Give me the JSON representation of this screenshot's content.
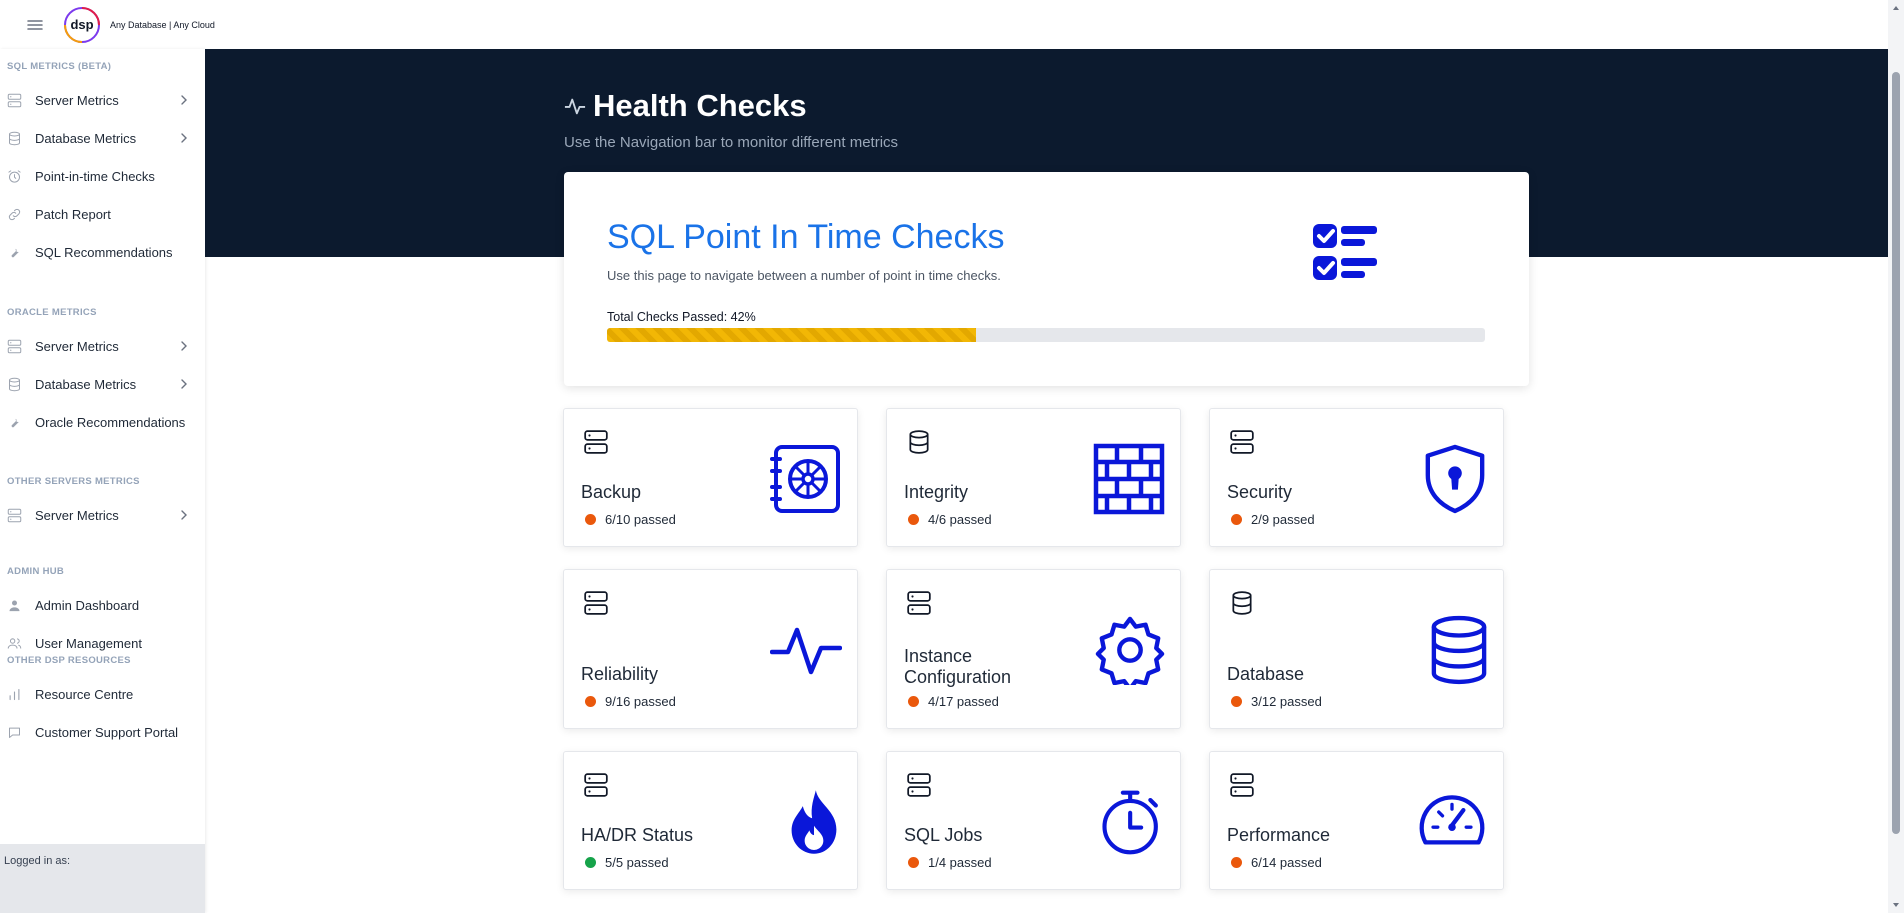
{
  "header": {
    "tagline": "Any Database | Any Cloud",
    "logo_text": "dsp"
  },
  "sidebar": {
    "sections": [
      {
        "title": "SQL METRICS (BETA)",
        "items": [
          {
            "label": "Server Metrics",
            "icon": "server-icon",
            "chevron": true
          },
          {
            "label": "Database Metrics",
            "icon": "database-icon",
            "chevron": true
          },
          {
            "label": "Point-in-time Checks",
            "icon": "alarm-icon",
            "chevron": false
          },
          {
            "label": "Patch Report",
            "icon": "link-icon",
            "chevron": false
          },
          {
            "label": "SQL Recommendations",
            "icon": "wrench-icon",
            "chevron": false
          }
        ]
      },
      {
        "title": "ORACLE METRICS",
        "items": [
          {
            "label": "Server Metrics",
            "icon": "server-icon",
            "chevron": true
          },
          {
            "label": "Database Metrics",
            "icon": "database-icon",
            "chevron": true
          },
          {
            "label": "Oracle Recommendations",
            "icon": "wrench-icon",
            "chevron": false
          }
        ]
      },
      {
        "title": "OTHER SERVERS METRICS",
        "items": [
          {
            "label": "Server Metrics",
            "icon": "server-icon",
            "chevron": true
          }
        ]
      },
      {
        "title": "ADMIN HUB",
        "items": [
          {
            "label": "Admin Dashboard",
            "icon": "user-icon",
            "chevron": false
          },
          {
            "label": "User Management",
            "icon": "users-icon",
            "chevron": false
          }
        ]
      },
      {
        "title": "OTHER DSP RESOURCES",
        "items": [
          {
            "label": "Resource Centre",
            "icon": "bar-chart-icon",
            "chevron": false
          },
          {
            "label": "Customer Support Portal",
            "icon": "chat-icon",
            "chevron": false
          }
        ]
      }
    ],
    "footer": "Logged in as:"
  },
  "page": {
    "title": "Health Checks",
    "subtitle": "Use the Navigation bar to monitor different metrics"
  },
  "summary": {
    "title": "SQL Point In Time Checks",
    "subtitle": "Use this page to navigate between a number of point in time checks.",
    "progress_label": "Total Checks Passed: 42%",
    "progress_percent": 42
  },
  "colors": {
    "accent_blue": "#1a73e8",
    "icon_blue": "#0a17d9",
    "hero_bg": "#0c1a2e",
    "warn": "#ea580c",
    "ok": "#16a34a",
    "progress": "#f2b705"
  },
  "cards": [
    {
      "name": "Backup",
      "passed": "6/10 passed",
      "status": "warn",
      "small_icon": "server-icon",
      "icon": "safe-icon"
    },
    {
      "name": "Integrity",
      "passed": "4/6 passed",
      "status": "warn",
      "small_icon": "database-icon",
      "icon": "brick-wall-icon"
    },
    {
      "name": "Security",
      "passed": "2/9 passed",
      "status": "warn",
      "small_icon": "server-icon",
      "icon": "shield-keyhole-icon"
    },
    {
      "name": "Reliability",
      "passed": "9/16 passed",
      "status": "warn",
      "small_icon": "server-icon",
      "icon": "pulse-icon"
    },
    {
      "name": "Instance Configuration",
      "passed": "4/17 passed",
      "status": "warn",
      "small_icon": "server-icon",
      "icon": "gear-icon"
    },
    {
      "name": "Database",
      "passed": "3/12 passed",
      "status": "warn",
      "small_icon": "database-icon",
      "icon": "database-stack-icon"
    },
    {
      "name": "HA/DR Status",
      "passed": "5/5 passed",
      "status": "ok",
      "small_icon": "server-icon",
      "icon": "flame-icon"
    },
    {
      "name": "SQL Jobs",
      "passed": "1/4 passed",
      "status": "warn",
      "small_icon": "server-icon",
      "icon": "stopwatch-icon"
    },
    {
      "name": "Performance",
      "passed": "6/14 passed",
      "status": "warn",
      "small_icon": "server-icon",
      "icon": "speedometer-icon"
    }
  ]
}
